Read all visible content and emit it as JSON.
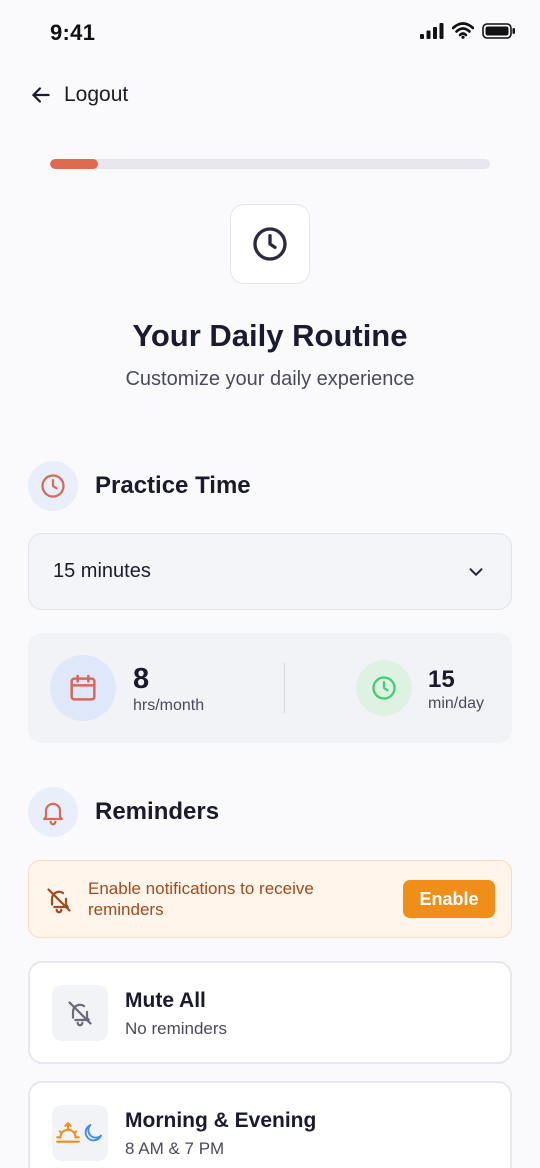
{
  "status_bar": {
    "time": "9:41"
  },
  "header": {
    "back_label": "Logout"
  },
  "progress": {
    "fraction": 0.11
  },
  "hero": {
    "icon": "clock-icon",
    "title": "Your Daily Routine",
    "subtitle": "Customize your daily experience"
  },
  "practice": {
    "title": "Practice Time",
    "icon": "clock-icon",
    "select_value": "15 minutes",
    "stats": [
      {
        "icon": "calendar-icon",
        "value": "8",
        "label": "hrs/month"
      },
      {
        "icon": "clock-icon",
        "value": "15",
        "label": "min/day"
      }
    ]
  },
  "reminders": {
    "title": "Reminders",
    "icon": "bell-icon",
    "banner": {
      "icon": "bell-off-icon",
      "text": "Enable notifications to receive reminders",
      "button_label": "Enable"
    },
    "options": [
      {
        "icon": "bell-off-icon",
        "title": "Mute All",
        "subtitle": "No reminders"
      },
      {
        "icon": "sunrise-moon-icon",
        "title": "Morning & Evening",
        "subtitle": "8 AM & 7 PM"
      }
    ]
  },
  "colors": {
    "accent": "#de6a4f",
    "enable_button": "#ef8f1a",
    "clock_green": "#3ccf6a"
  }
}
